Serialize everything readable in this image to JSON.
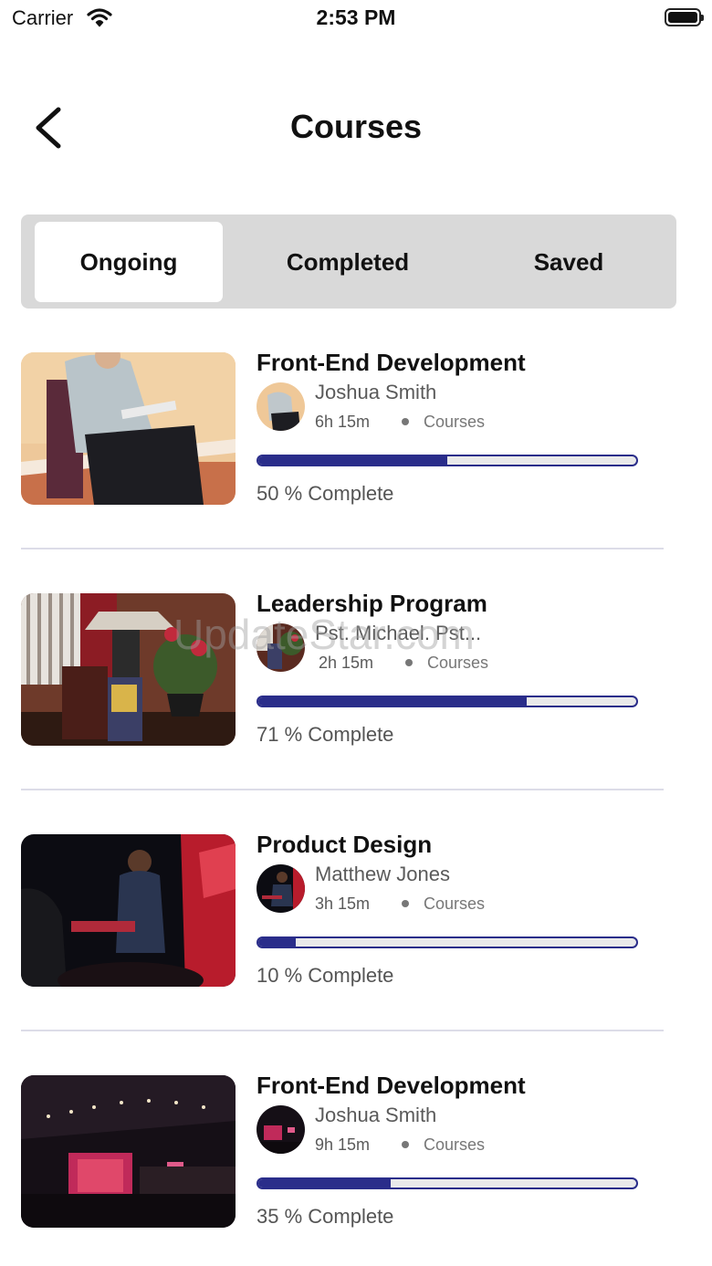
{
  "status_bar": {
    "carrier": "Carrier",
    "time": "2:53 PM"
  },
  "header": {
    "title": "Courses"
  },
  "tabs": [
    {
      "label": "Ongoing",
      "active": true
    },
    {
      "label": "Completed",
      "active": false
    },
    {
      "label": "Saved",
      "active": false
    }
  ],
  "colors": {
    "accent": "#2a2d8a",
    "segment_bg": "#d9d9d9",
    "divider": "#dcdce8"
  },
  "courses": [
    {
      "title": "Front-End Development",
      "author": "Joshua Smith",
      "duration": "6h 15m",
      "type": "Courses",
      "progress": 0.5,
      "progress_label": "50 % Complete"
    },
    {
      "title": "Leadership Program",
      "author": "Pst. Michael. Pst...",
      "duration": "2h 15m",
      "type": "Courses",
      "progress": 0.71,
      "progress_label": "71 % Complete"
    },
    {
      "title": "Product Design",
      "author": "Matthew Jones",
      "duration": "3h 15m",
      "type": "Courses",
      "progress": 0.1,
      "progress_label": "10 % Complete"
    },
    {
      "title": "Front-End Development",
      "author": "Joshua Smith",
      "duration": "9h 15m",
      "type": "Courses",
      "progress": 0.35,
      "progress_label": "35 % Complete"
    }
  ],
  "watermark": "UpdateStar.com"
}
